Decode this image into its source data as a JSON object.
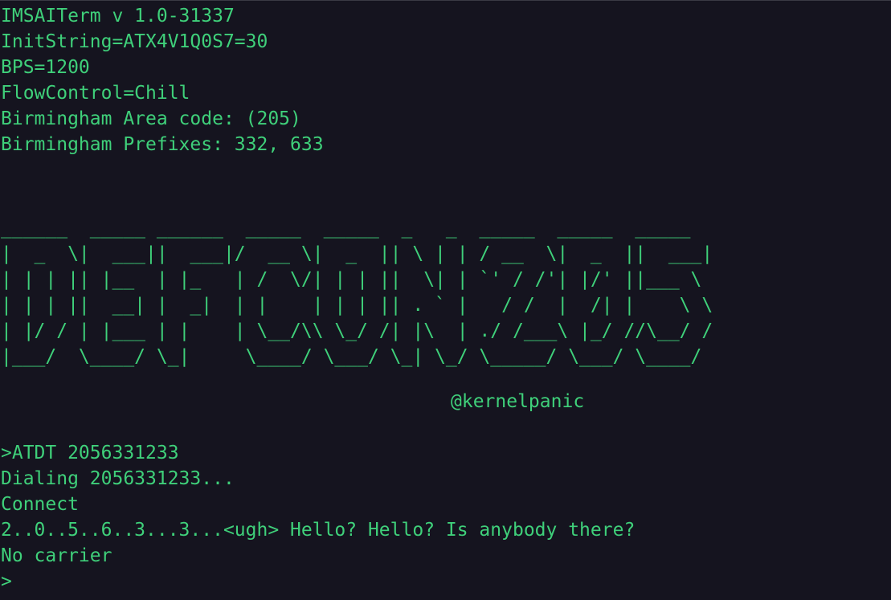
{
  "header": {
    "title": "IMSAITerm v 1.0-31337",
    "init_string": "InitString=ATX4V1Q0S7=30",
    "bps": "BPS=1200",
    "flow_control": "FlowControl=Chill",
    "area_code": "Birmingham Area code: (205)",
    "prefixes": "Birmingham Prefixes: 332, 633"
  },
  "banner": {
    "lines": [
      "______  _____ ______  _____  _____  _   _  _____  _____  _____ ",
      "|  _  \\|  ___||  ___|/  __ \\|  _  || \\ | | / __  \\|  _  ||  ___|",
      "| | | || |__  | |_   | /  \\/| | | ||  \\| | `' / /'| |/' ||___ \\ ",
      "| | | ||  __| |  _|  | |    | | | || . ` |   / /  |  /| |    \\ \\",
      "| |/ / | |___ | |    | \\__/\\\\ \\_/ /| |\\  | ./ /___\\ |_/ //\\__/ /",
      "|___/  \\____/ \\_|     \\____/ \\___/ \\_| \\_/ \\_____/ \\___/ \\____/ "
    ],
    "author": "@kernelpanic"
  },
  "session": {
    "command": ">ATDT 2056331233",
    "dialing": "Dialing 2056331233...",
    "connect": "Connect",
    "message": "2..0..5..6..3...3...<ugh> Hello? Hello? Is anybody there?",
    "no_carrier": "No carrier",
    "prompt": ">"
  },
  "colors": {
    "background": "#15141f",
    "text": "#3fd07a"
  }
}
